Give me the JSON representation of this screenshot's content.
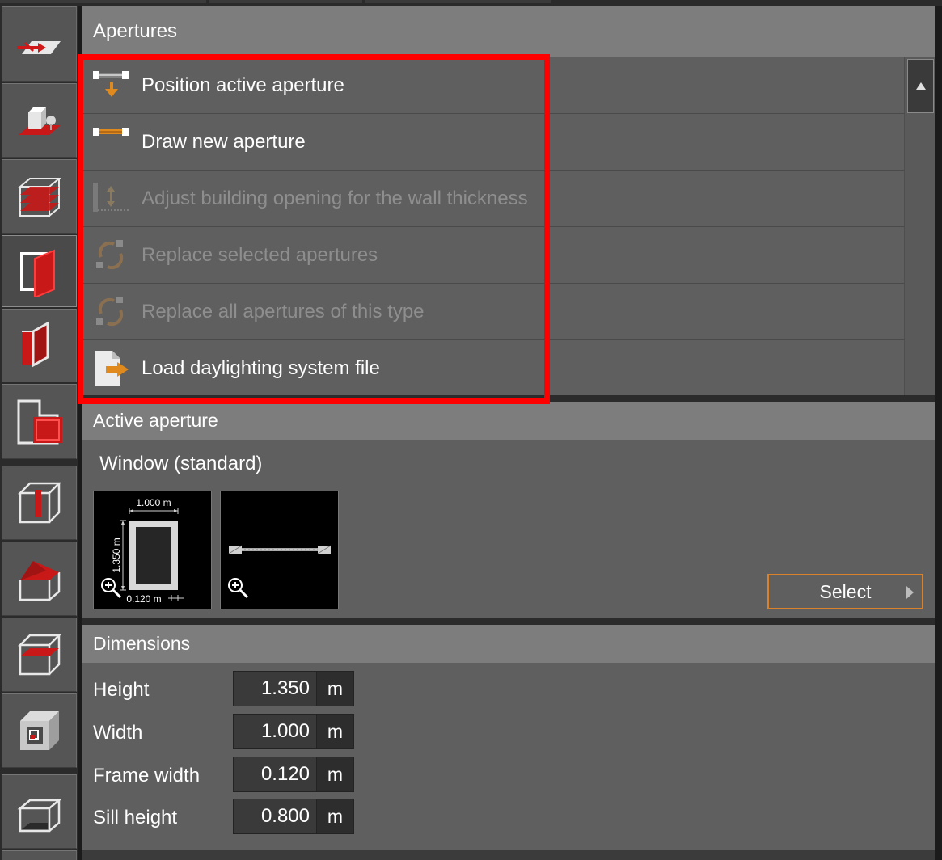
{
  "apertures": {
    "title": "Apertures",
    "actions": [
      {
        "label": "Position active aperture",
        "icon": "position-aperture-icon",
        "enabled": true
      },
      {
        "label": "Draw new aperture",
        "icon": "draw-aperture-icon",
        "enabled": true
      },
      {
        "label": "Adjust building opening for the wall thickness",
        "icon": "adjust-opening-icon",
        "enabled": false
      },
      {
        "label": "Replace selected apertures",
        "icon": "replace-icon",
        "enabled": false
      },
      {
        "label": "Replace all apertures of this type",
        "icon": "replace-icon",
        "enabled": false
      },
      {
        "label": "Load daylighting system file",
        "icon": "load-file-icon",
        "enabled": true
      }
    ]
  },
  "active_aperture": {
    "title": "Active aperture",
    "name": "Window (standard)",
    "front_view": {
      "width_label": "1.000 m",
      "height_label": "1.350 m",
      "frame_label": "0.120 m"
    },
    "select_label": "Select"
  },
  "dimensions": {
    "title": "Dimensions",
    "rows": [
      {
        "label": "Height",
        "value": "1.350",
        "unit": "m"
      },
      {
        "label": "Width",
        "value": "1.000",
        "unit": "m"
      },
      {
        "label": "Frame width",
        "value": "0.120",
        "unit": "m"
      },
      {
        "label": "Sill height",
        "value": "0.800",
        "unit": "m"
      }
    ]
  },
  "colors": {
    "highlight": "#ff0000",
    "accent_orange": "#d9822b",
    "tool_red": "#cc1a1a"
  }
}
